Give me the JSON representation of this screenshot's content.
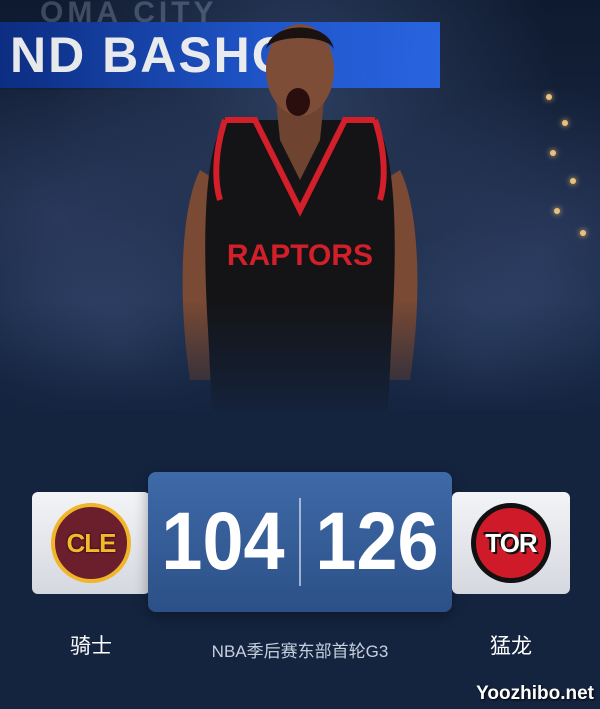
{
  "hero": {
    "banner_text": "ND BASHO",
    "arena_text": "OMA CITY"
  },
  "matchup": {
    "home": {
      "abbr": "CLE",
      "name": "骑士",
      "score": "104",
      "color": "#6b1f2c"
    },
    "away": {
      "abbr": "TOR",
      "name": "猛龙",
      "score": "126",
      "color": "#cf1a2a"
    },
    "event": "NBA季后赛东部首轮G3"
  },
  "watermark": "Yoozhibo.net",
  "jersey_text": "RAPTORS"
}
